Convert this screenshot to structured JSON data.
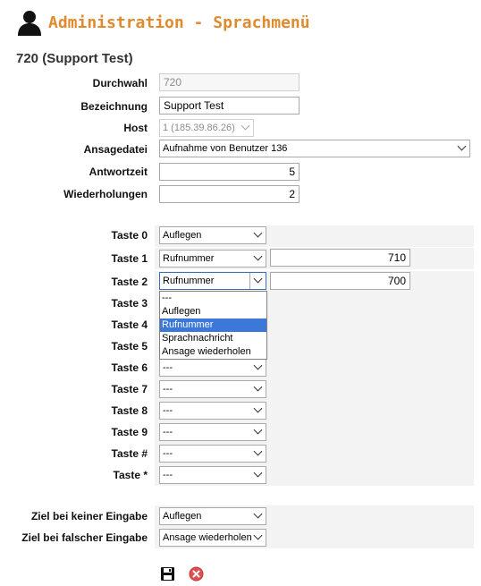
{
  "header": {
    "title": "Administration - Sprachmenü",
    "subtitle": "720 (Support Test)"
  },
  "fields": {
    "durchwahl": {
      "label": "Durchwahl",
      "value": "720"
    },
    "bezeichnung": {
      "label": "Bezeichnung",
      "value": "Support Test"
    },
    "host": {
      "label": "Host",
      "value": "1 (185.39.86.26)"
    },
    "ansagedatei": {
      "label": "Ansagedatei",
      "value": "Aufnahme von Benutzer 136"
    },
    "antwortzeit": {
      "label": "Antwortzeit",
      "value": "5"
    },
    "wiederholungen": {
      "label": "Wiederholungen",
      "value": "2"
    }
  },
  "keys": [
    {
      "label": "Taste 0",
      "action": "Auflegen",
      "number": ""
    },
    {
      "label": "Taste 1",
      "action": "Rufnummer",
      "number": "710"
    },
    {
      "label": "Taste 2",
      "action": "Rufnummer",
      "number": "700"
    },
    {
      "label": "Taste 3",
      "action": "---",
      "number": ""
    },
    {
      "label": "Taste 4",
      "action": "---",
      "number": ""
    },
    {
      "label": "Taste 5",
      "action": "---",
      "number": ""
    },
    {
      "label": "Taste 6",
      "action": "---",
      "number": ""
    },
    {
      "label": "Taste 7",
      "action": "---",
      "number": ""
    },
    {
      "label": "Taste 8",
      "action": "---",
      "number": ""
    },
    {
      "label": "Taste 9",
      "action": "---",
      "number": ""
    },
    {
      "label": "Taste #",
      "action": "---",
      "number": ""
    },
    {
      "label": "Taste *",
      "action": "---",
      "number": ""
    }
  ],
  "dropdown_options": [
    "---",
    "Auflegen",
    "Rufnummer",
    "Sprachnachricht",
    "Ansage wiederholen"
  ],
  "dropdown_highlighted": "Rufnummer",
  "fallback": {
    "no_input": {
      "label": "Ziel bei keiner Eingabe",
      "value": "Auflegen"
    },
    "wrong_input": {
      "label": "Ziel bei falscher Eingabe",
      "value": "Ansage wiederholen"
    }
  },
  "actions": {
    "save_icon": "save-icon",
    "cancel_icon": "cancel-icon"
  },
  "colors": {
    "title": "#e08a2e",
    "cancel": "#e05050",
    "highlight": "#3b78d8"
  }
}
